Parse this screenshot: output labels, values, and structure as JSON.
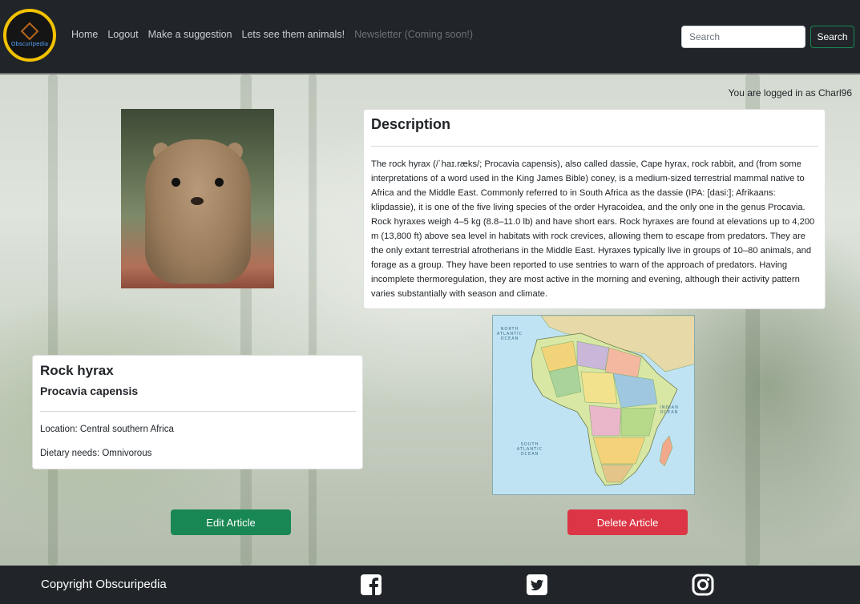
{
  "nav": {
    "logo_text": "Obscuripedia",
    "links": [
      {
        "label": "Home"
      },
      {
        "label": "Logout"
      },
      {
        "label": "Make a suggestion"
      },
      {
        "label": "Lets see them animals!"
      },
      {
        "label": "Newsletter (Coming soon!)"
      }
    ],
    "search_placeholder": "Search",
    "search_button": "Search"
  },
  "user": {
    "logged_in_text": "You are logged in as Charl96"
  },
  "description": {
    "heading": "Description",
    "body": "The rock hyrax (/ˈhaɪ.ræks/; Procavia capensis), also called dassie, Cape hyrax, rock rabbit, and (from some interpretations of a word used in the King James Bible) coney, is a medium-sized terrestrial mammal native to Africa and the Middle East. Commonly referred to in South Africa as the dassie (IPA: [dasi:]; Afrikaans: klipdassie), it is one of the five living species of the order Hyracoidea, and the only one in the genus Procavia. Rock hyraxes weigh 4–5 kg (8.8–11.0 lb) and have short ears. Rock hyraxes are found at elevations up to 4,200 m (13,800 ft) above sea level in habitats with rock crevices, allowing them to escape from predators. They are the only extant terrestrial afrotherians in the Middle East. Hyraxes typically live in groups of 10–80 animals, and forage as a group. They have been reported to use sentries to warn of the approach of predators. Having incomplete thermoregulation, they are most active in the morning and evening, although their activity pattern varies substantially with season and climate."
  },
  "animal": {
    "common_name": "Rock hyrax",
    "scientific_name": "Procavia capensis",
    "location": "Location: Central southern Africa",
    "diet": "Dietary needs: Omnivorous"
  },
  "map": {
    "labels": [
      "NORTH ATLANTIC OCEAN",
      "INDIAN OCEAN",
      "SOUTH ATLANTIC OCEAN"
    ]
  },
  "actions": {
    "edit": "Edit Article",
    "delete": "Delete Article"
  },
  "footer": {
    "copyright": "Copyright Obscuripedia",
    "icons": [
      "facebook-icon",
      "twitter-icon",
      "instagram-icon"
    ]
  },
  "colors": {
    "navbar": "#212529",
    "edit_button": "#198754",
    "delete_button": "#dc3545",
    "logo_ring": "#f2c100"
  }
}
